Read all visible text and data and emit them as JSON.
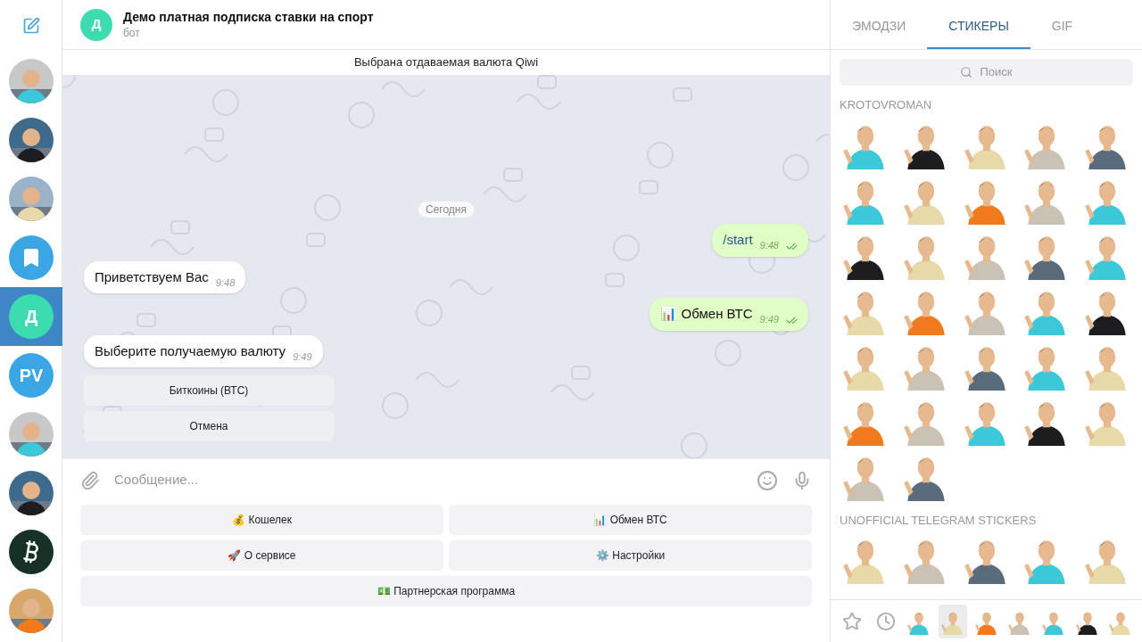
{
  "chat_list": [
    {
      "kind": "picture",
      "selected": false
    },
    {
      "kind": "picture",
      "selected": false
    },
    {
      "kind": "picture",
      "selected": false
    },
    {
      "kind": "bookmark",
      "selected": false
    },
    {
      "kind": "letter",
      "initials": "Д",
      "color": "#3ddcb0",
      "selected": true
    },
    {
      "kind": "letter",
      "initials": "PV",
      "color": "#3aa6e4",
      "selected": false
    },
    {
      "kind": "picture",
      "selected": false
    },
    {
      "kind": "picture",
      "selected": false
    },
    {
      "kind": "bitcoin",
      "selected": false
    },
    {
      "kind": "picture",
      "selected": false
    }
  ],
  "header": {
    "avatar": "Д",
    "title": "Демо платная подписка ставки на спорт",
    "subtitle": "бот"
  },
  "pinned_bar": "Выбрана отдаваемая валюта Qiwi",
  "date_label": "Сегодня",
  "messages": [
    {
      "kind": "outgoing",
      "text": "/start",
      "time": "9:48",
      "read": true
    },
    {
      "kind": "incoming",
      "text": "Приветствуем Вас",
      "time": "9:48"
    },
    {
      "kind": "outgoing",
      "text": "📊 Обмен ВТС",
      "time": "9:49",
      "read": true
    },
    {
      "kind": "incoming",
      "text": "Выберите получаемую валюту",
      "time": "9:49"
    }
  ],
  "inline_buttons": [
    "Биткоины (ВТС)",
    "Отмена"
  ],
  "composer": {
    "placeholder": "Сообщение..."
  },
  "keyboard": [
    [
      "💰 Кошелек",
      "📊 Обмен ВТС"
    ],
    [
      "🚀 О сервисе",
      "⚙️ Настройки"
    ],
    [
      "💵 Партнерская программа"
    ]
  ],
  "panel_tabs": [
    {
      "label": "ЭМОДЗИ",
      "selected": false
    },
    {
      "label": "СТИКЕРЫ",
      "selected": true
    },
    {
      "label": "GIF",
      "selected": false
    }
  ],
  "panel_search": {
    "placeholder": "Поиск"
  },
  "sticker_sets": [
    {
      "title": "KROTOVROMAN",
      "stickers": [
        {
          "kind": "picture"
        },
        {
          "kind": "picture"
        },
        {
          "kind": "picture"
        },
        {
          "kind": "picture"
        },
        {
          "kind": "picture"
        },
        {
          "kind": "picture"
        },
        {
          "kind": "picture"
        },
        {
          "kind": "picture"
        },
        {
          "kind": "picture"
        },
        {
          "kind": "picture"
        },
        {
          "kind": "picture"
        },
        {
          "kind": "picture"
        },
        {
          "kind": "picture"
        },
        {
          "kind": "picture"
        },
        {
          "kind": "picture"
        },
        {
          "kind": "picture"
        },
        {
          "kind": "picture"
        },
        {
          "kind": "picture"
        },
        {
          "kind": "picture"
        },
        {
          "kind": "picture"
        },
        {
          "kind": "picture"
        },
        {
          "kind": "picture"
        },
        {
          "kind": "picture"
        },
        {
          "kind": "picture"
        },
        {
          "kind": "picture"
        },
        {
          "kind": "picture"
        },
        {
          "kind": "picture"
        },
        {
          "kind": "picture"
        },
        {
          "kind": "picture"
        },
        {
          "kind": "picture"
        },
        {
          "kind": "picture"
        },
        {
          "kind": "picture"
        }
      ]
    },
    {
      "title": "UNOFFICIAL TELEGRAM STICKERS",
      "stickers": [
        {
          "kind": "picture"
        },
        {
          "kind": "picture"
        },
        {
          "kind": "picture"
        },
        {
          "kind": "picture"
        },
        {
          "kind": "picture"
        }
      ]
    }
  ],
  "set_bar": [
    {
      "kind": "favorites",
      "selected": false
    },
    {
      "kind": "recent",
      "selected": false
    },
    {
      "kind": "picture",
      "selected": false
    },
    {
      "kind": "picture",
      "selected": true
    },
    {
      "kind": "picture",
      "selected": false
    },
    {
      "kind": "picture",
      "selected": false
    },
    {
      "kind": "picture",
      "selected": false
    },
    {
      "kind": "picture",
      "selected": false
    },
    {
      "kind": "picture",
      "selected": false
    }
  ]
}
